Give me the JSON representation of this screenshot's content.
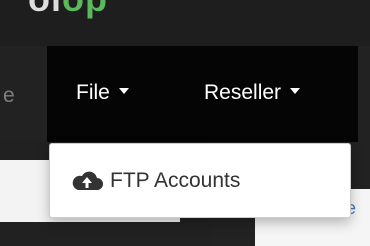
{
  "logo": {
    "text_a": "ol",
    "text_b": "op"
  },
  "navbar": {
    "cut_item": "e",
    "items": [
      {
        "label": "File"
      },
      {
        "label": "Reseller"
      }
    ]
  },
  "dropdown": {
    "items": [
      {
        "icon": "cloud-upload-icon",
        "label": "FTP Accounts"
      }
    ]
  },
  "content": {
    "link_fragment": "e"
  }
}
